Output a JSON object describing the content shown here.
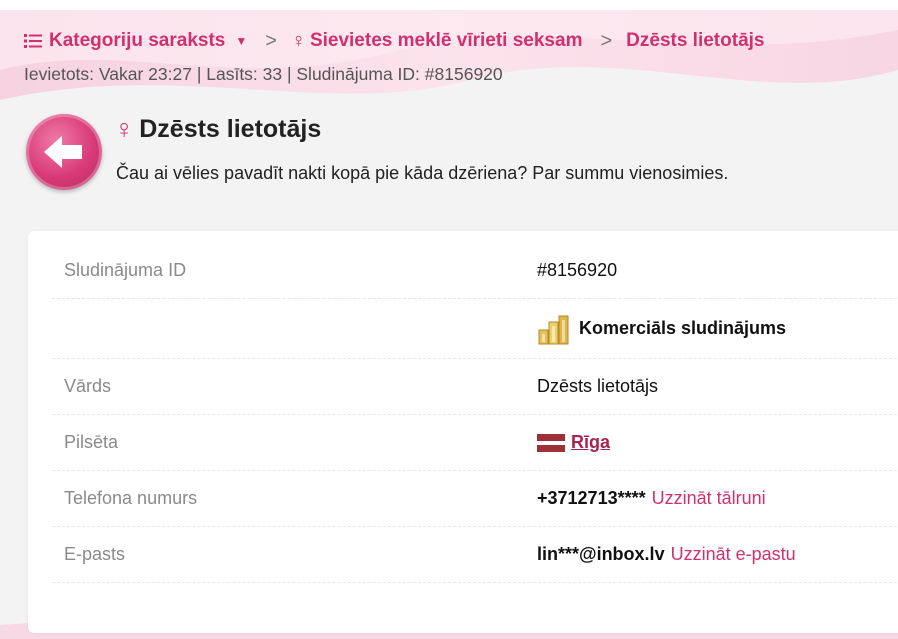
{
  "breadcrumb": {
    "categories_label": "Kategoriju saraksts",
    "section_label": "Sievietes meklē vīrieti seksam",
    "current_label": "Dzēsts lietotājs"
  },
  "meta_line": "Ievietots: Vakar 23:27 | Lasīts: 33 | Sludinājuma ID: #8156920",
  "ad": {
    "title": "Dzēsts lietotājs",
    "description": "Čau ai vēlies pavadīt nakti kopā pie kāda dzēriena? Par summu vienosimies."
  },
  "details": {
    "id_label": "Sludinājuma ID",
    "id_value": "#8156920",
    "commercial_label": "Komerciāls sludinājums",
    "name_label": "Vārds",
    "name_value": "Dzēsts lietotājs",
    "city_label": "Pilsēta",
    "city_value": "Rīga",
    "phone_label": "Telefona numurs",
    "phone_value": "+3712713****",
    "phone_link": "Uzzināt tālruni",
    "email_label": "E-pasts",
    "email_value": "lin***@inbox.lv",
    "email_link": "Uzzināt e-pastu"
  },
  "colors": {
    "accent": "#d0316e",
    "city_link": "#a8244f",
    "flag": "#9e3039"
  },
  "icons": [
    "list-icon",
    "chevron-down-icon",
    "chevron-right-icon",
    "female-icon",
    "back-arrow-icon",
    "coins-icon",
    "latvia-flag-icon"
  ]
}
